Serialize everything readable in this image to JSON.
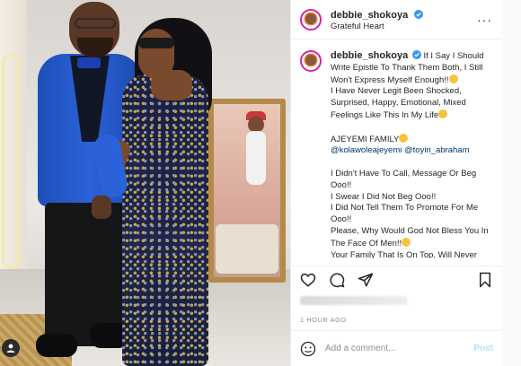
{
  "post": {
    "username": "debbie_shokoya",
    "location": "Grateful Heart",
    "caption_lines": [
      "If I Say I Should Write Epistle To Thank Them Both, I Still Won't Express Myself Enough!!",
      "I Have Never Legit Been Shocked, Surprised, Happy, Emotional, Mixed Feelings Like This In My Life",
      "AJEYEMI FAMILY",
      "@kolawoleajeyemi @toyin_abraham",
      "I Didn't Have To Call, Message Or Beg Ooo!!",
      "I Swear I Did Not Beg Ooo!!",
      "I Did Not Tell Them To Promote For Me Ooo!!",
      "Please, Why Would God Not Bless You In The Face Of Men!!",
      "Your Family That Is On Top, Will Never Come Down!!"
    ],
    "mention_1": "@kolawoleajeyemi",
    "mention_2": "@toyin_abraham",
    "timestamp": "1 HOUR AGO",
    "comment_placeholder": "Add a comment...",
    "post_button": "Post"
  },
  "icons": {
    "more": "more-icon",
    "like": "heart-icon",
    "comment": "comment-icon",
    "share": "share-icon",
    "save": "bookmark-icon",
    "emoji": "smiley-icon",
    "verified": "verified-badge-icon"
  },
  "colors": {
    "link": "#00376b",
    "post_button_disabled": "#b2dffc",
    "verified": "#3897f0"
  }
}
